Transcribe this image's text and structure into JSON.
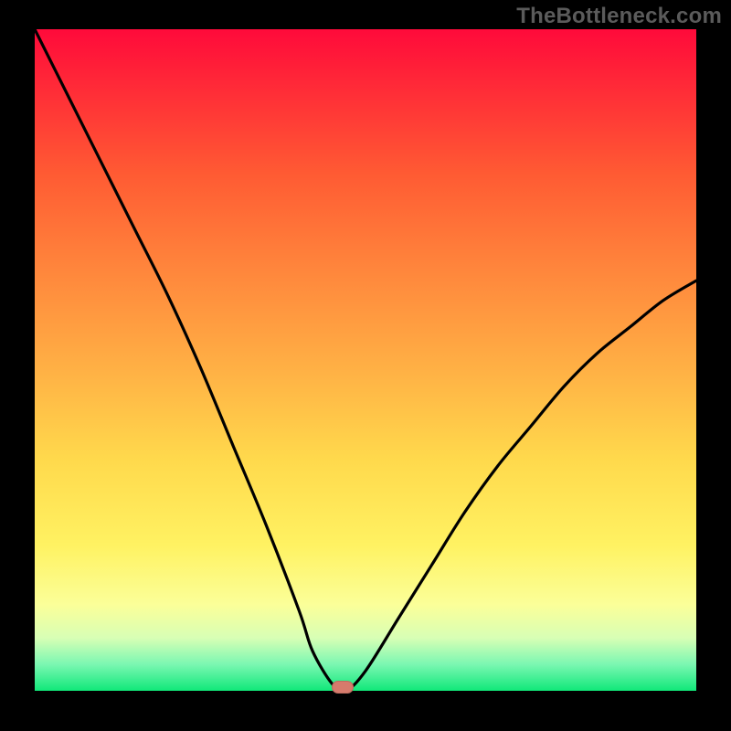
{
  "watermark": "TheBottleneck.com",
  "colors": {
    "curve_stroke": "#000000",
    "marker_fill": "#d77b6c",
    "frame_bg": "#000000"
  },
  "chart_data": {
    "type": "line",
    "title": "",
    "xlabel": "",
    "ylabel": "",
    "xlim": [
      0,
      100
    ],
    "ylim": [
      0,
      100
    ],
    "grid": false,
    "legend": false,
    "series": [
      {
        "name": "bottleneck-curve",
        "x": [
          0,
          5,
          10,
          15,
          20,
          25,
          30,
          35,
          40,
          42,
          45,
          47,
          50,
          55,
          60,
          65,
          70,
          75,
          80,
          85,
          90,
          95,
          100
        ],
        "values": [
          100,
          90,
          80,
          70,
          60,
          49,
          37,
          25,
          12,
          6,
          1,
          0,
          3,
          11,
          19,
          27,
          34,
          40,
          46,
          51,
          55,
          59,
          62
        ]
      }
    ],
    "marker": {
      "x": 46.5,
      "y": 0.6
    },
    "gradient_stops": [
      {
        "pct": 0,
        "color": "#ff0a3a"
      },
      {
        "pct": 22,
        "color": "#ff5b33"
      },
      {
        "pct": 52,
        "color": "#ffb245"
      },
      {
        "pct": 78,
        "color": "#fff262"
      },
      {
        "pct": 92,
        "color": "#d8ffb5"
      },
      {
        "pct": 100,
        "color": "#10e879"
      }
    ]
  }
}
